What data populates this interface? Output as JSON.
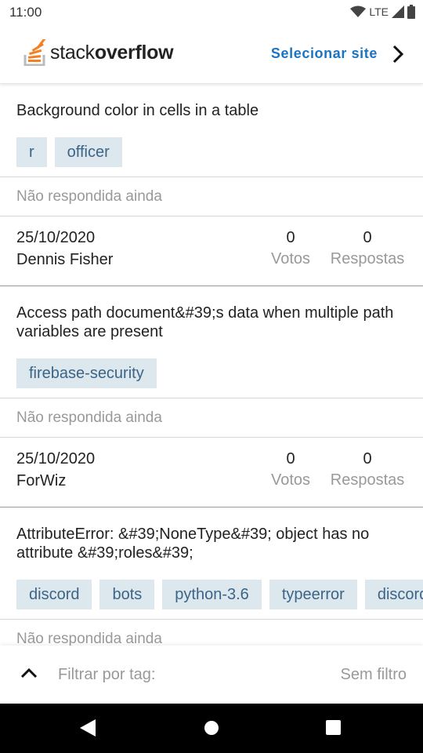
{
  "status_bar": {
    "time": "11:00",
    "network": "LTE"
  },
  "header": {
    "logo_light": "stack",
    "logo_bold": "overflow",
    "select_site": "Selecionar site"
  },
  "questions": [
    {
      "title": "Background color in cells in a table",
      "tags": [
        "r",
        "officer"
      ],
      "status": "Não respondida ainda",
      "date": "25/10/2020",
      "author": "Dennis Fisher",
      "votes": "0",
      "votes_label": "Votos",
      "answers": "0",
      "answers_label": "Respostas"
    },
    {
      "title": "Access path document&#39;s data when multiple path variables are present",
      "tags": [
        "firebase-security"
      ],
      "status": "Não respondida ainda",
      "date": "25/10/2020",
      "author": "ForWiz",
      "votes": "0",
      "votes_label": "Votos",
      "answers": "0",
      "answers_label": "Respostas"
    },
    {
      "title": "AttributeError: &#39;NoneType&#39; object has no attribute &#39;roles&#39;",
      "tags": [
        "discord",
        "bots",
        "python-3.6",
        "typeerror",
        "discord"
      ],
      "status": "Não respondida ainda"
    }
  ],
  "filter": {
    "label": "Filtrar por tag:",
    "value": "Sem filtro"
  }
}
